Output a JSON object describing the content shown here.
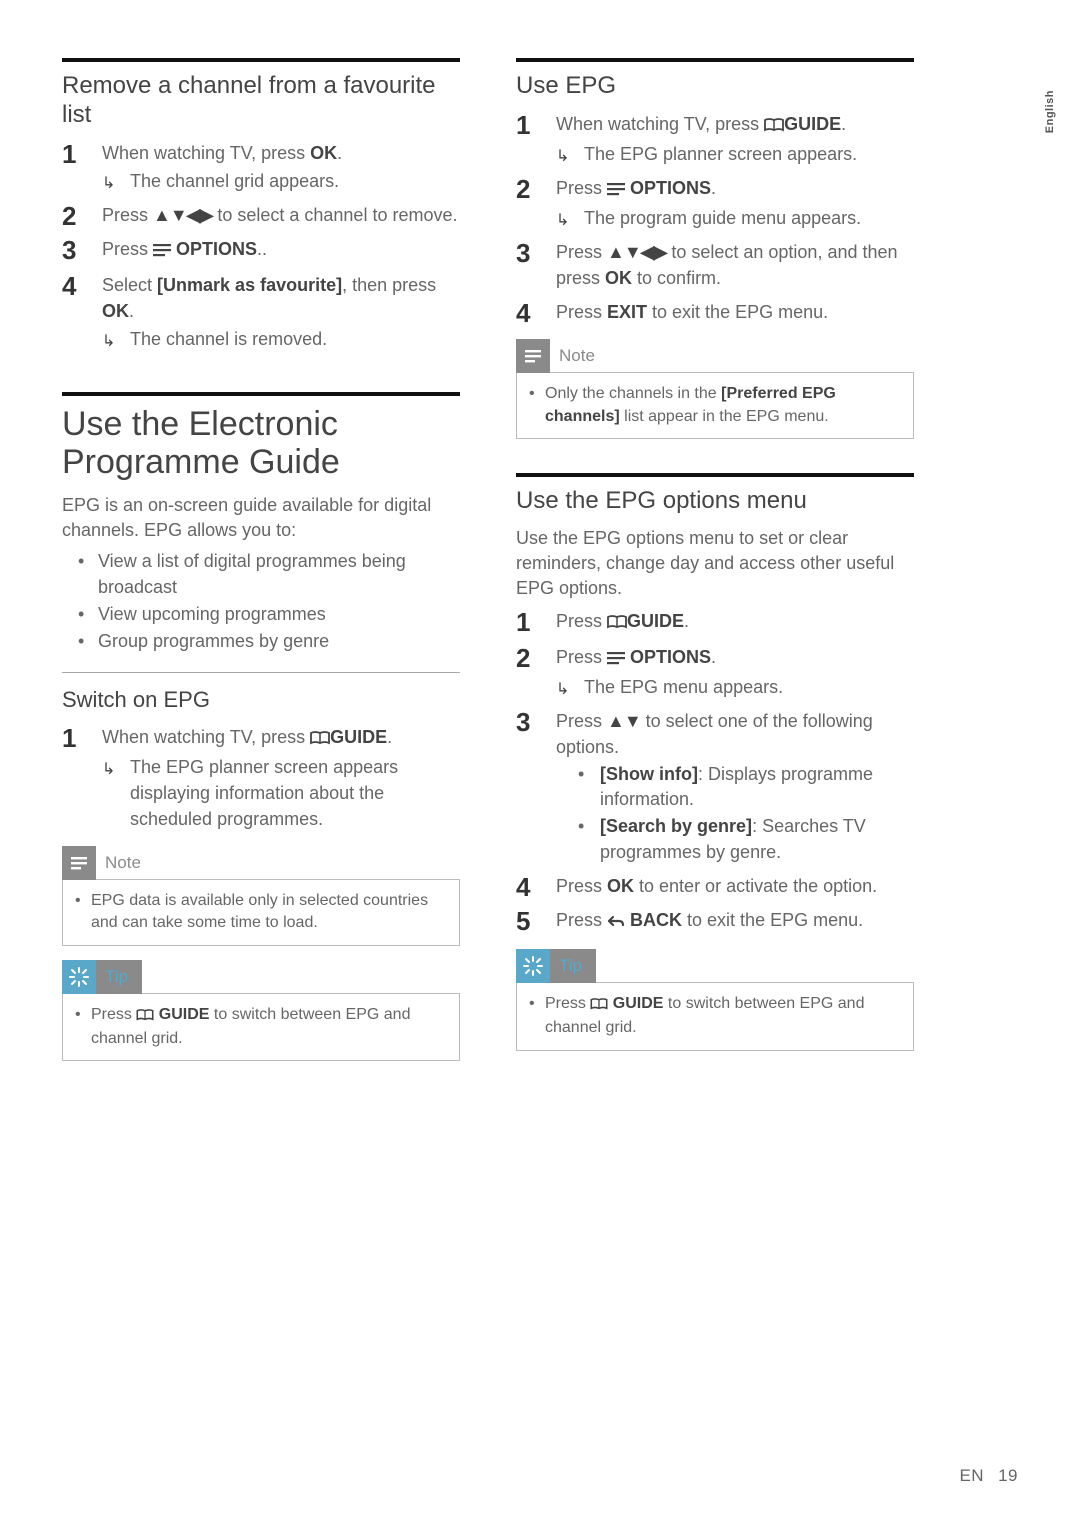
{
  "side_tab": "English",
  "left": {
    "remove": {
      "title": "Remove a channel from a favourite list",
      "steps": [
        {
          "t": "When watching TV, press ",
          "b": "OK",
          "after": ".",
          "r": "The channel grid appears."
        },
        {
          "t": "Press ▲▼◀▶ to select a channel to remove."
        },
        {
          "t": "Press ",
          "i": "options",
          "b": "OPTIONS",
          "after": ".."
        },
        {
          "t": "Select ",
          "b": "[Unmark as favourite]",
          "after": ", then press ",
          "b2": "OK",
          "after2": ".",
          "r": "The channel is removed."
        }
      ]
    },
    "epg_title": "Use the Electronic Programme Guide",
    "epg_body": "EPG is an on-screen guide available for digital channels. EPG allows you to:",
    "epg_bullets": [
      "View a list of digital programmes being broadcast",
      "View upcoming programmes",
      "Group programmes by genre"
    ],
    "switch": {
      "title": "Switch on EPG",
      "step1_t": "When watching TV, press ",
      "step1_b": "GUIDE",
      "step1_after": ".",
      "step1_r": "The EPG planner screen appears displaying information about the scheduled programmes."
    },
    "note1": "EPG data is available only in selected countries and can take some time to load.",
    "tip1_a": "Press ",
    "tip1_b": " GUIDE",
    "tip1_c": " to switch between EPG and channel grid."
  },
  "right": {
    "useepg": {
      "title": "Use EPG",
      "steps": [
        {
          "t": "When watching TV, press ",
          "i": "book",
          "b": "GUIDE",
          "after": ".",
          "r": "The EPG planner screen appears."
        },
        {
          "t": "Press ",
          "i": "options",
          "b": "OPTIONS",
          "after": ".",
          "r": "The program guide menu appears."
        },
        {
          "t": "Press ▲▼◀▶ to select an option, and then press ",
          "b": "OK",
          "after": " to confirm."
        },
        {
          "t": "Press ",
          "b": "EXIT",
          "after": " to exit the EPG menu."
        }
      ]
    },
    "note2_a": "Only the channels in the ",
    "note2_b": "[Preferred EPG channels]",
    "note2_c": " list appear in the EPG menu.",
    "menu": {
      "title": "Use the EPG options menu",
      "body": "Use the EPG options menu to set or clear reminders, change day and access other useful EPG options.",
      "s1_t": "Press ",
      "s1_b": "GUIDE",
      "s1_after": ".",
      "s2_t": "Press ",
      "s2_b": "OPTIONS",
      "s2_after": ".",
      "s2_r": "The EPG menu appears.",
      "s3_t": "Press ▲▼ to select one of the following options.",
      "s3_opts": [
        {
          "b": "[Show info]",
          "t": ": Displays programme information."
        },
        {
          "b": "[Search by genre]",
          "t": ": Searches TV programmes by genre."
        }
      ],
      "s4_t": "Press ",
      "s4_b": "OK",
      "s4_after": " to enter or activate the option.",
      "s5_t": "Press ",
      "s5_b": "BACK",
      "s5_after": " to exit the EPG menu."
    },
    "tip2_a": "Press ",
    "tip2_b": " GUIDE",
    "tip2_c": " to switch between EPG and channel grid."
  },
  "labels": {
    "note": "Note",
    "tip": "Tip"
  },
  "footer": {
    "lang": "EN",
    "page": "19"
  }
}
